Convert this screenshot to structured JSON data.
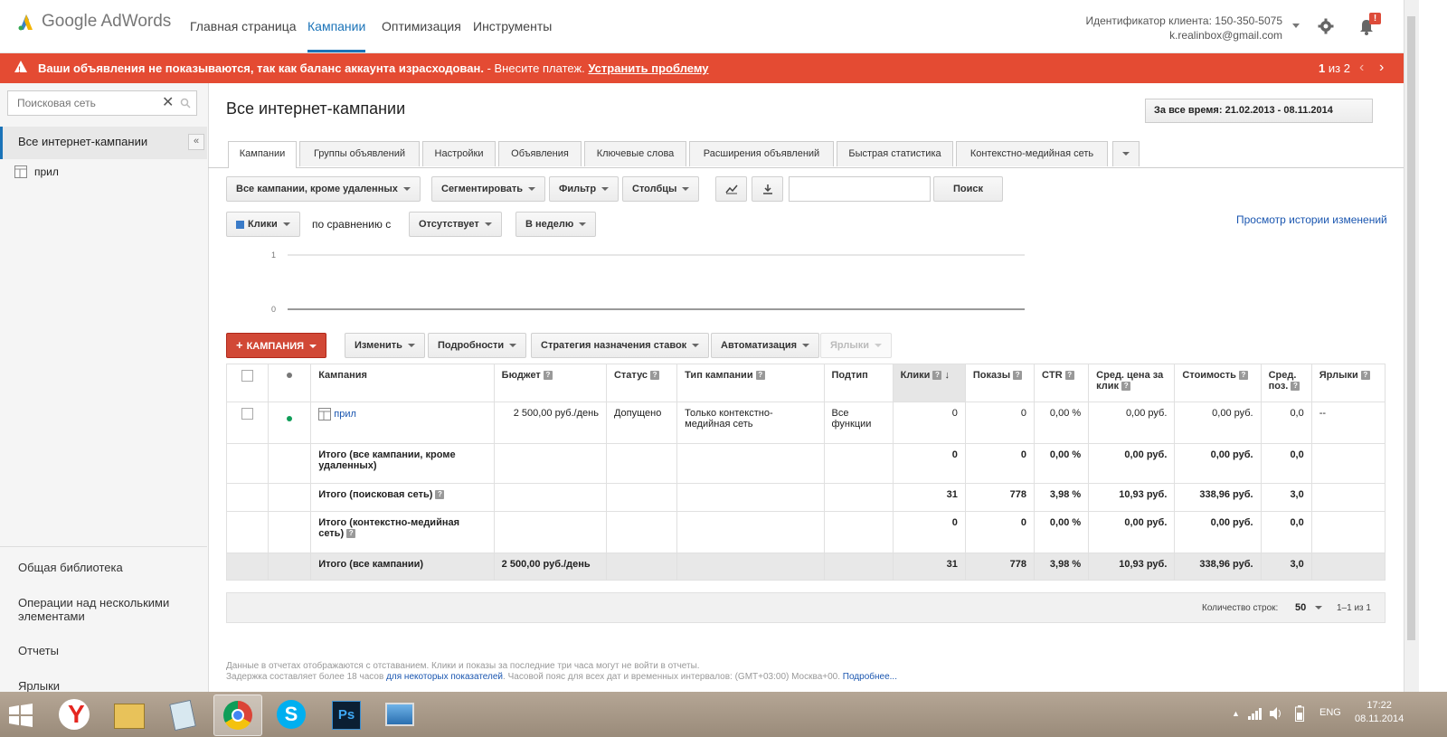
{
  "header": {
    "logo_text": "Google AdWords",
    "nav": [
      "Главная страница",
      "Кампании",
      "Оптимизация",
      "Инструменты"
    ],
    "client_id": "Идентификатор клиента: 150-350-5075",
    "email": "k.realinbox@gmail.com",
    "notification_badge": "!"
  },
  "alert": {
    "message": "Ваши объявления не показываются, так как баланс аккаунта израсходован.",
    "extra": " - Внесите платеж.",
    "fix_link": "Устранить проблему",
    "pager_current": "1",
    "pager_total": "из 2"
  },
  "sidebar": {
    "search_placeholder": "Поисковая сеть",
    "all_campaigns": "Все интернет-кампании",
    "campaign": "прил",
    "bottom_links": [
      "Общая библиотека",
      "Операции над несколькими элементами",
      "Отчеты",
      "Ярлыки"
    ]
  },
  "main": {
    "title": "Все интернет-кампании",
    "date_range": "За все время: 21.02.2013 - 08.11.2014",
    "tabs": [
      "Кампании",
      "Группы объявлений",
      "Настройки",
      "Объявления",
      "Ключевые слова",
      "Расширения объявлений",
      "Быстрая статистика",
      "Контекстно-медийная сеть"
    ],
    "toolbar": {
      "filter_scope": "Все кампании, кроме удаленных",
      "segment": "Сегментировать",
      "filter": "Фильтр",
      "columns": "Столбцы",
      "search_button": "Поиск"
    },
    "chart_controls": {
      "metric": "Клики",
      "compare_label": "по сравнению с",
      "compare_value": "Отсутствует",
      "period": "В неделю",
      "history_link": "Просмотр истории изменений"
    },
    "chart_ticks": [
      "1",
      "0"
    ],
    "actions": {
      "add_campaign": "КАМПАНИЯ",
      "edit": "Изменить",
      "details": "Подробности",
      "bid_strategy": "Стратегия назначения ставок",
      "automation": "Автоматизация",
      "labels": "Ярлыки"
    }
  },
  "table": {
    "headers": {
      "campaign": "Кампания",
      "budget": "Бюджет",
      "status": "Статус",
      "type": "Тип кампании",
      "subtype": "Подтип",
      "clicks": "Клики",
      "impressions": "Показы",
      "ctr": "CTR",
      "avg_cpc": "Сред. цена за клик",
      "cost": "Стоимость",
      "avg_pos": "Сред. поз.",
      "labels": "Ярлыки"
    },
    "rows": [
      {
        "campaign": "прил",
        "budget": "2 500,00 руб./день",
        "status": "Допущено",
        "type": "Только контекстно-медийная сеть",
        "subtype": "Все функции",
        "clicks": "0",
        "impressions": "0",
        "ctr": "0,00 %",
        "avg_cpc": "0,00 руб.",
        "cost": "0,00 руб.",
        "avg_pos": "0,0",
        "labels": "--"
      }
    ],
    "totals": [
      {
        "label": "Итого (все кампании, кроме удаленных)",
        "budget": "",
        "clicks": "0",
        "impressions": "0",
        "ctr": "0,00 %",
        "avg_cpc": "0,00 руб.",
        "cost": "0,00 руб.",
        "avg_pos": "0,0"
      },
      {
        "label": "Итого (поисковая сеть)",
        "budget": "",
        "clicks": "31",
        "impressions": "778",
        "ctr": "3,98 %",
        "avg_cpc": "10,93 руб.",
        "cost": "338,96 руб.",
        "avg_pos": "3,0"
      },
      {
        "label": "Итого (контекстно-медийная сеть)",
        "budget": "",
        "clicks": "0",
        "impressions": "0",
        "ctr": "0,00 %",
        "avg_cpc": "0,00 руб.",
        "cost": "0,00 руб.",
        "avg_pos": "0,0"
      },
      {
        "label": "Итого (все кампании)",
        "budget": "2 500,00 руб./день",
        "clicks": "31",
        "impressions": "778",
        "ctr": "3,98 %",
        "avg_cpc": "10,93 руб.",
        "cost": "338,96 руб.",
        "avg_pos": "3,0"
      }
    ],
    "pagination": {
      "rows_label": "Количество строк:",
      "rows_value": "50",
      "range": "1–1 из 1"
    }
  },
  "footer": {
    "line1": "Данные в отчетах отображаются с отставанием. Клики и показы за последние три часа могут не войти в отчеты.",
    "line2_a": "Задержка составляет более 18 часов ",
    "line2_link": "для некоторых показателей",
    "line2_b": ". Часовой пояс для всех дат и временных интервалов: (GMT+03:00) Москва+00. ",
    "line2_more": "Подробнее..."
  },
  "taskbar": {
    "lang": "ENG",
    "time": "17:22",
    "date": "08.11.2014"
  },
  "colors": {
    "alert_bg": "#e44b33",
    "accent": "#1a73b8",
    "add_button": "#d14836",
    "status_dot": "#0f9d58"
  }
}
